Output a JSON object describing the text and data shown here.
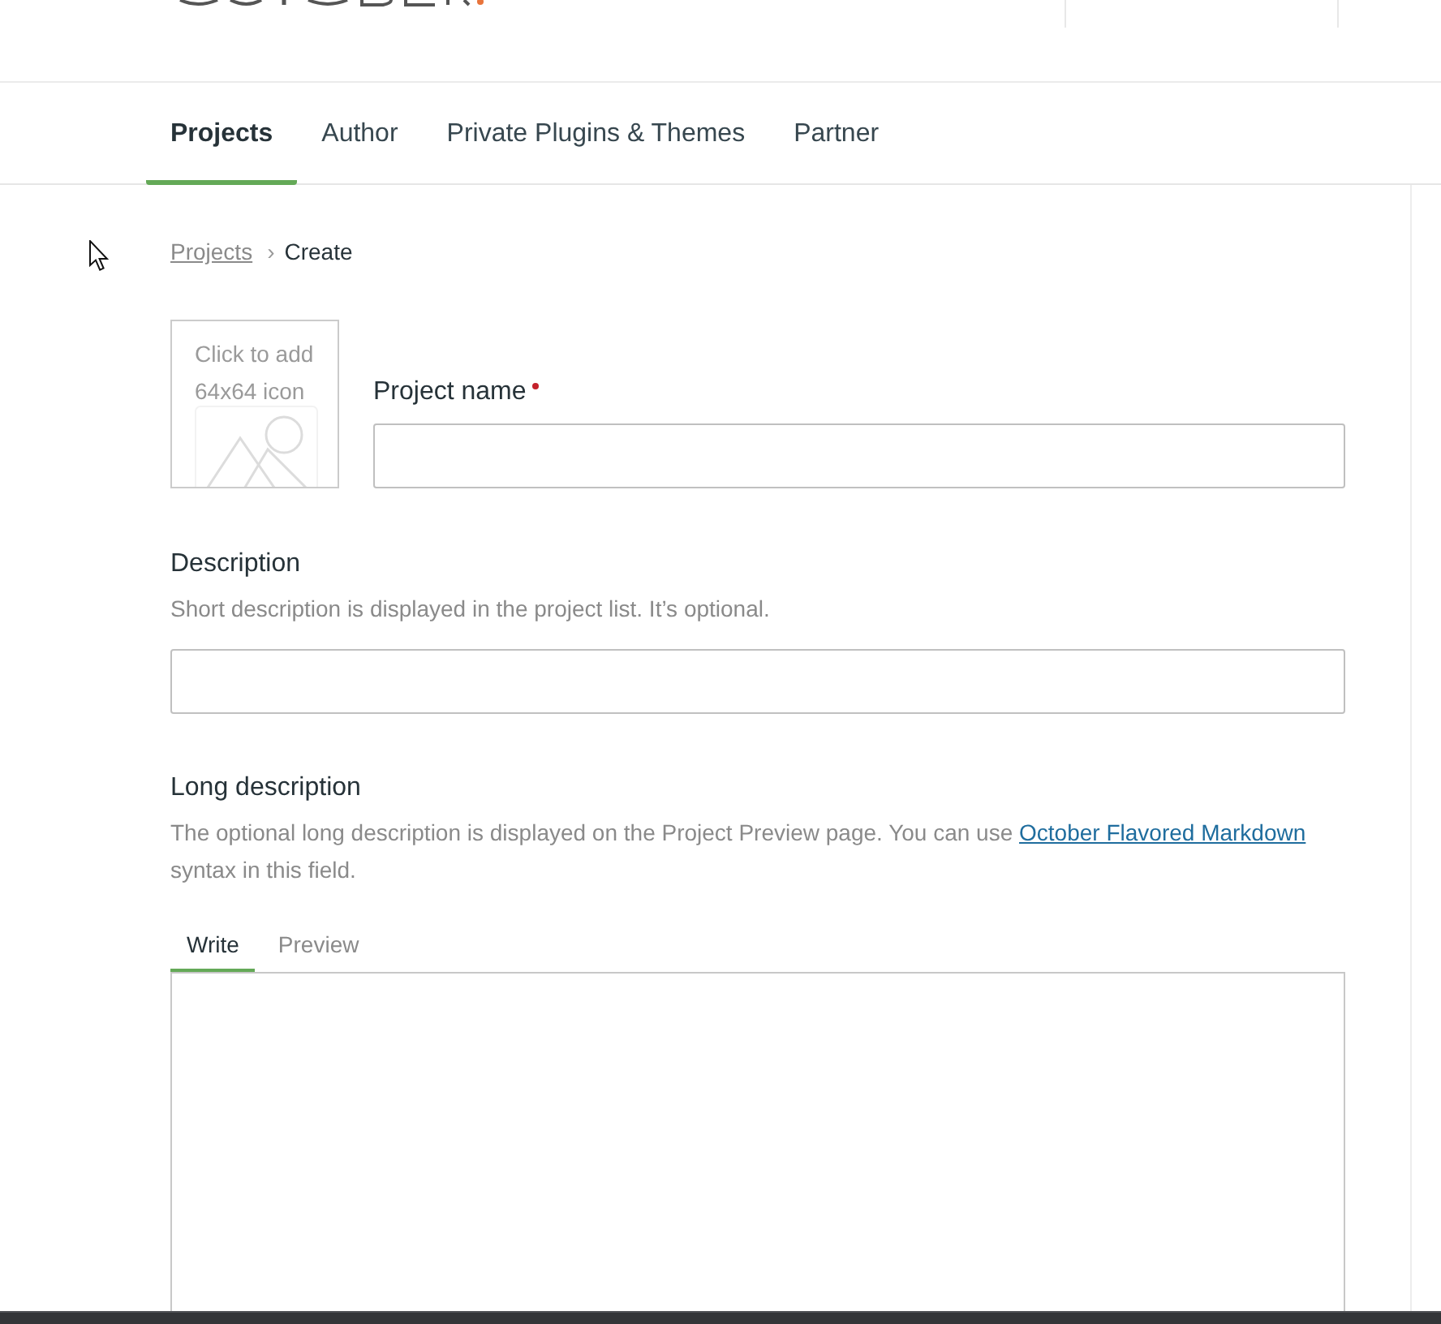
{
  "nav": {
    "tabs": [
      {
        "label": "Projects",
        "selected": true
      },
      {
        "label": "Author",
        "selected": false
      },
      {
        "label": "Private Plugins & Themes",
        "selected": false
      },
      {
        "label": "Partner",
        "selected": false
      }
    ]
  },
  "breadcrumb": {
    "items": [
      {
        "label": "Projects",
        "kind": "link"
      },
      {
        "label": "Create",
        "kind": "current"
      }
    ],
    "separator": "›"
  },
  "icon_upload": {
    "hint": "Click to add 64x64 icon"
  },
  "project_name": {
    "label": "Project name",
    "required": true
  },
  "description": {
    "label": "Description",
    "hint": "Short description is displayed in the project list. It’s optional."
  },
  "long_description": {
    "label": "Long description",
    "hint_parts": [
      {
        "kind": "text",
        "text": "The optional long description is displayed on the Project Preview page. You can use"
      },
      {
        "kind": "link",
        "text": "October Flavored Markdown"
      },
      {
        "kind": "text",
        "text": "syntax in this field."
      }
    ],
    "tabs": [
      {
        "label": "Write",
        "selected": true
      },
      {
        "label": "Preview",
        "selected": false
      }
    ]
  }
}
